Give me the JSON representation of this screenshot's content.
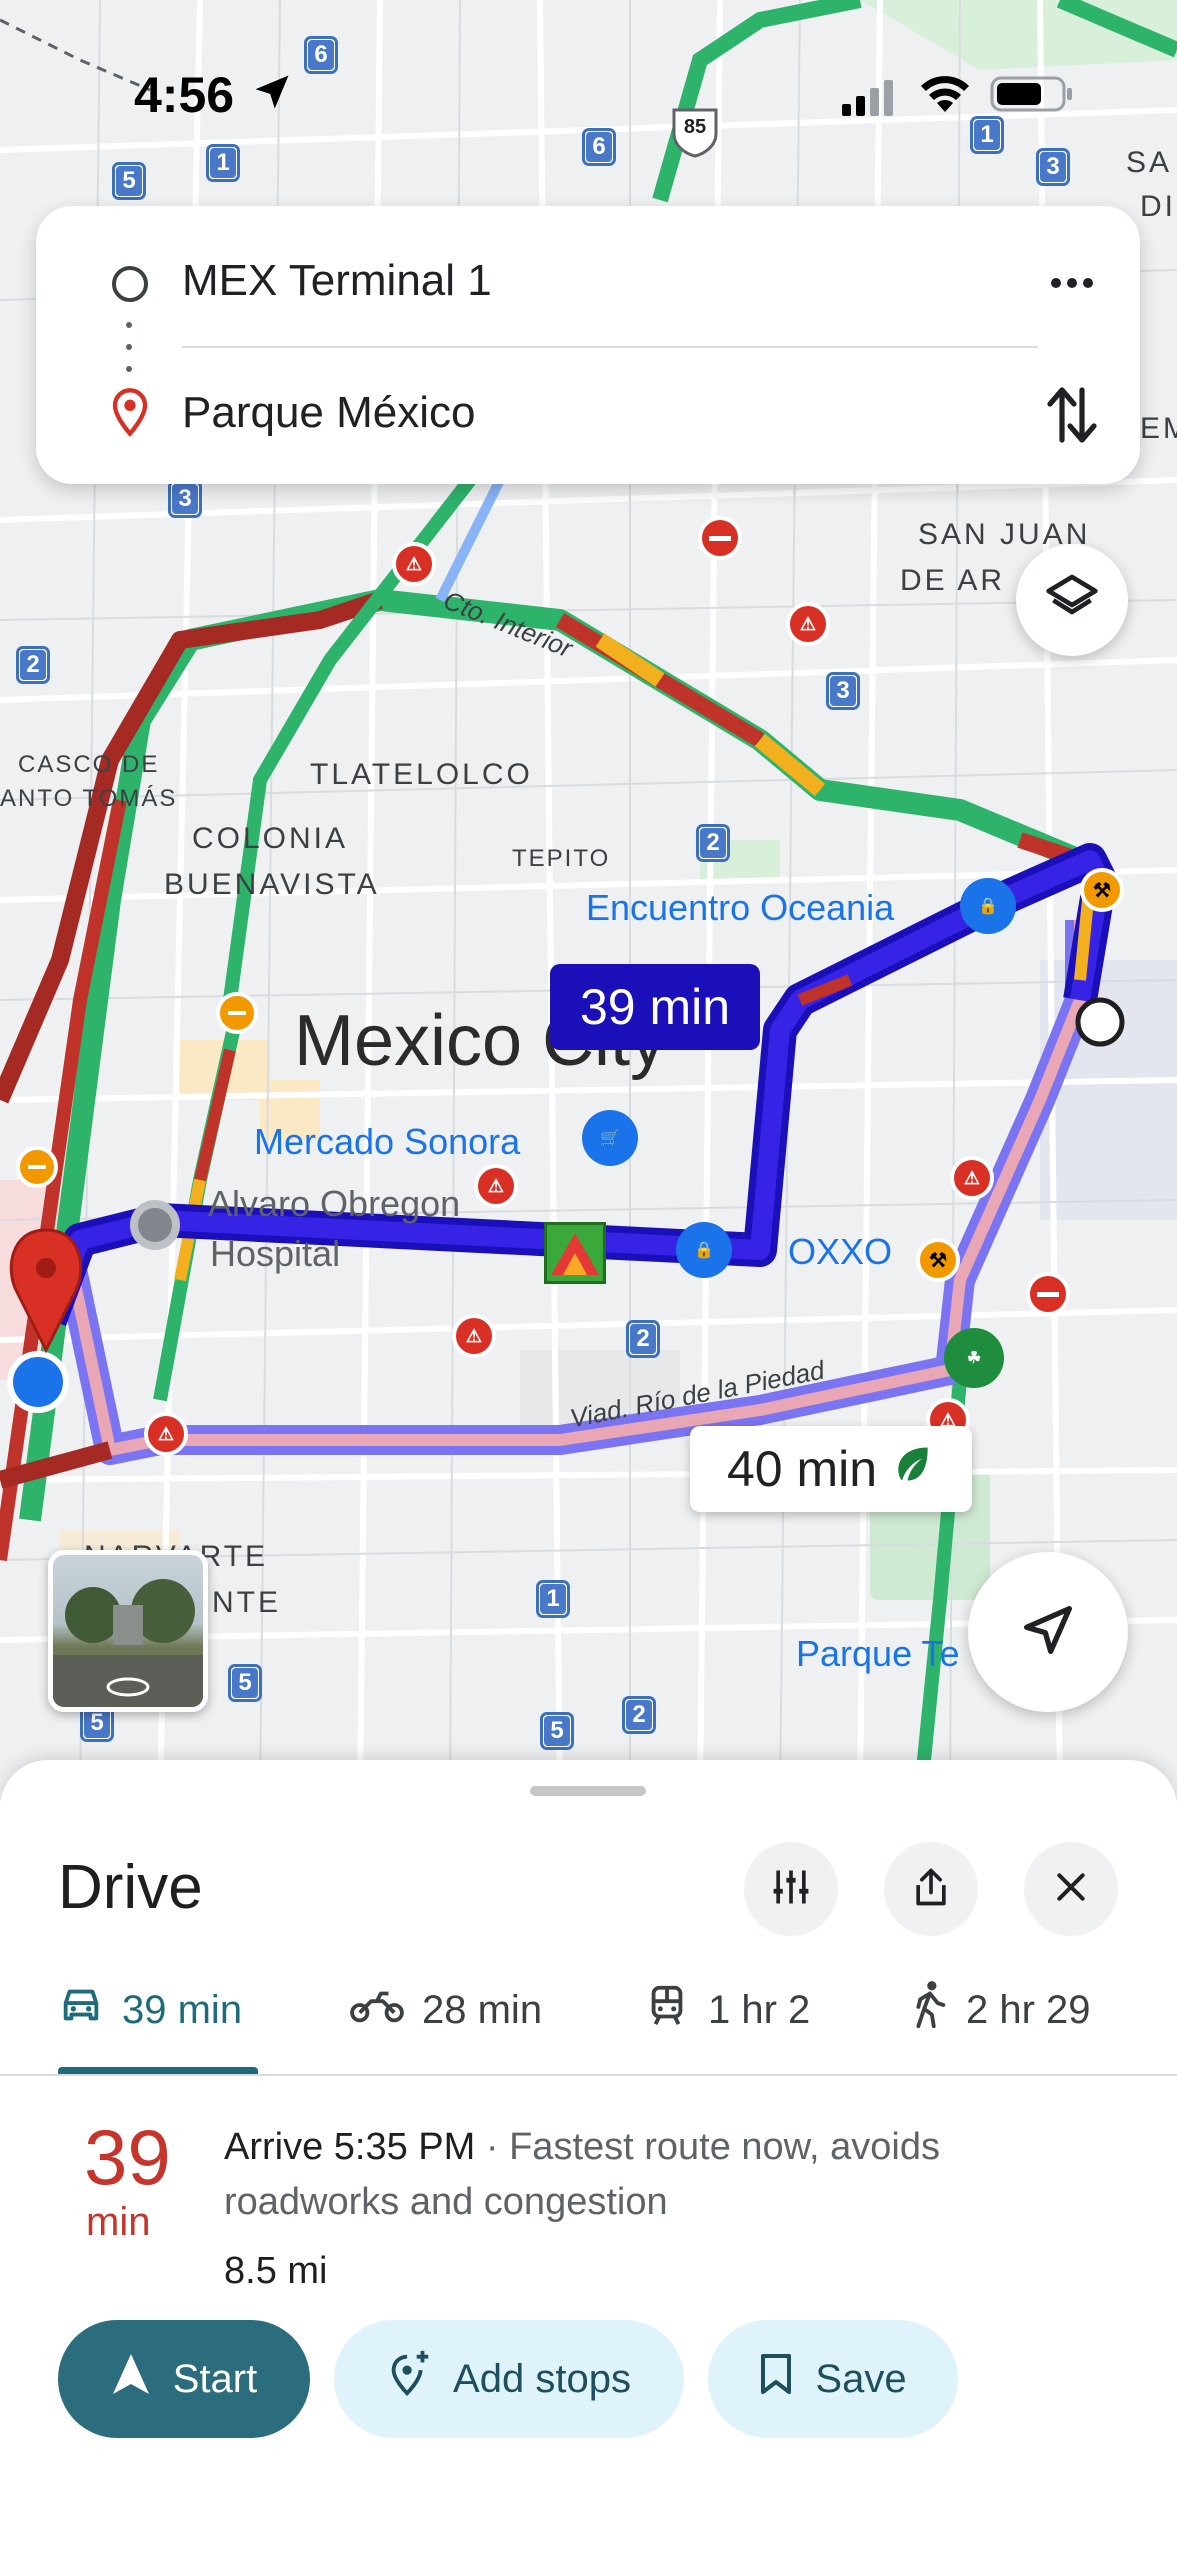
{
  "status_bar": {
    "time": "4:56"
  },
  "route": {
    "origin": "MEX Terminal 1",
    "destination": "Parque México",
    "more_icon": "more-horizontal-icon",
    "swap_icon": "swap-vertical-icon"
  },
  "map": {
    "city_label": "Mexico City",
    "districts": [
      "TLATELOLCO",
      "COLONIA",
      "BUENAVISTA",
      "TEPITO",
      "SAN JUAN",
      "DE AR",
      "CASCO DE",
      "ANTO TOMÁS",
      "NARVARTE",
      "NTE",
      "SA",
      "DI",
      "EM"
    ],
    "pois": [
      "Encuentro Oceania",
      "Mercado Sonora",
      "Alvaro Obregon",
      "Hospital",
      "OXXO",
      "Parque Te"
    ],
    "roads": [
      "Cto. Interior",
      "Viad. Río de la Piedad"
    ],
    "highway_shield": "85",
    "route_shields": [
      "6",
      "5",
      "1",
      "6",
      "1",
      "3",
      "3",
      "2",
      "3",
      "2",
      "2",
      "2",
      "1",
      "5",
      "5",
      "2",
      "5"
    ],
    "primary_route_time": "39 min",
    "alt_route_time": "40 min",
    "route_colors": {
      "primary": "#2a1ad8",
      "alt": "#7b74f2",
      "traffic_green": "#2eb36b",
      "traffic_yellow": "#f2b01e",
      "traffic_red": "#c0332a"
    }
  },
  "sheet": {
    "title": "Drive",
    "tabs": [
      {
        "icon": "car-icon",
        "label": "39 min"
      },
      {
        "icon": "motorcycle-icon",
        "label": "28 min"
      },
      {
        "icon": "transit-icon",
        "label": "1 hr 2"
      },
      {
        "icon": "walk-icon",
        "label": "2 hr 29"
      }
    ],
    "eta_value": "39",
    "eta_unit": "min",
    "arrive_label": "Arrive 5:35 PM",
    "arrive_sep": " · ",
    "route_desc": "Fastest route now, avoids roadworks and congestion",
    "distance": "8.5 mi",
    "buttons": {
      "start": "Start",
      "add_stops": "Add stops",
      "save": "Save"
    },
    "colors": {
      "accent": "#2b6d7c",
      "eta": "#c5352b",
      "light_button": "#dff3fb"
    }
  }
}
